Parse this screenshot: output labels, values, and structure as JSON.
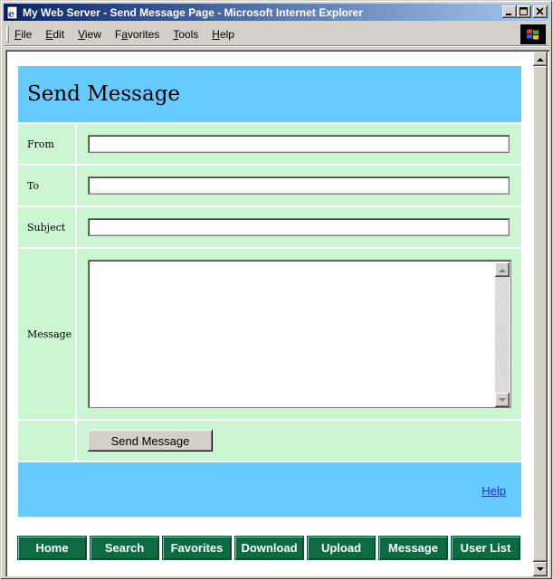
{
  "window": {
    "title": "My Web Server - Send Message Page - Microsoft Internet Explorer",
    "icon": "ie-page-icon"
  },
  "menu": {
    "items": [
      {
        "label": "File",
        "accel": "F",
        "rest": "ile"
      },
      {
        "label": "Edit",
        "accel": "E",
        "rest": "dit"
      },
      {
        "label": "View",
        "accel": "V",
        "rest": "iew"
      },
      {
        "label": "Favorites",
        "accel": "a",
        "pre": "F",
        "rest": "vorites"
      },
      {
        "label": "Tools",
        "accel": "T",
        "rest": "ools"
      },
      {
        "label": "Help",
        "accel": "H",
        "rest": "elp"
      }
    ]
  },
  "page": {
    "heading": "Send Message",
    "form": {
      "from_label": "From",
      "from_value": "",
      "to_label": "To",
      "to_value": "",
      "subject_label": "Subject",
      "subject_value": "",
      "message_label": "Message",
      "message_value": "",
      "send_label": "Send Message"
    },
    "help_link": "Help"
  },
  "nav": {
    "buttons": [
      "Home",
      "Search",
      "Favorites",
      "Download",
      "Upload",
      "Message",
      "User List"
    ]
  },
  "colors": {
    "header_band": "#66ccff",
    "form_row": "#ccf5d2",
    "nav_button": "#0d6b43"
  }
}
